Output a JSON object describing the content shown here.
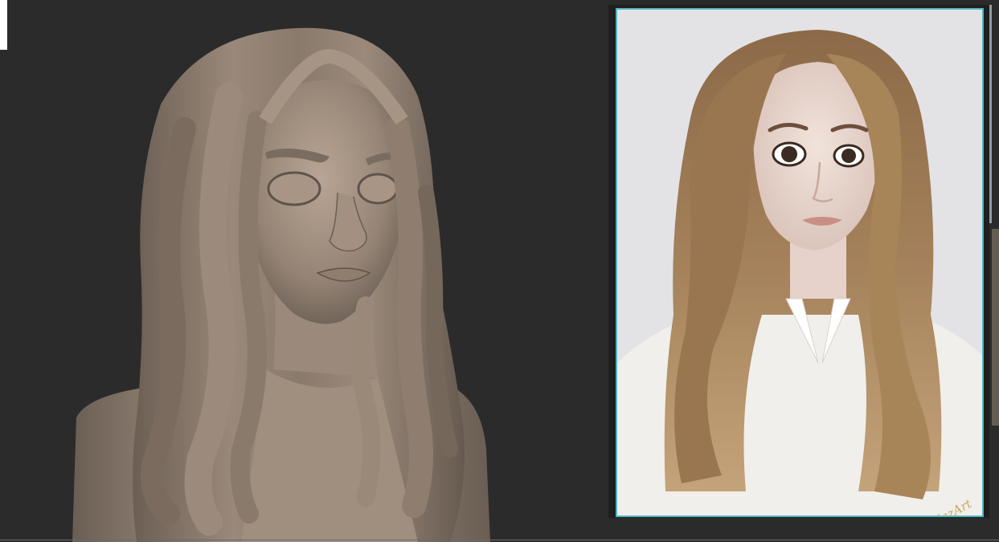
{
  "viewport": {
    "background": "#2b2b2b",
    "model_color": "#8f7f72",
    "model_highlight": "#b8a595",
    "model_shadow": "#5f544b"
  },
  "reference": {
    "frame_color": "#4fb6bf",
    "background": "#e6e6e8",
    "hair_color": "#a37f58",
    "skin_color": "#ead8d0",
    "shirt_color": "#f2f0ec",
    "signature_text": "NazArt"
  }
}
